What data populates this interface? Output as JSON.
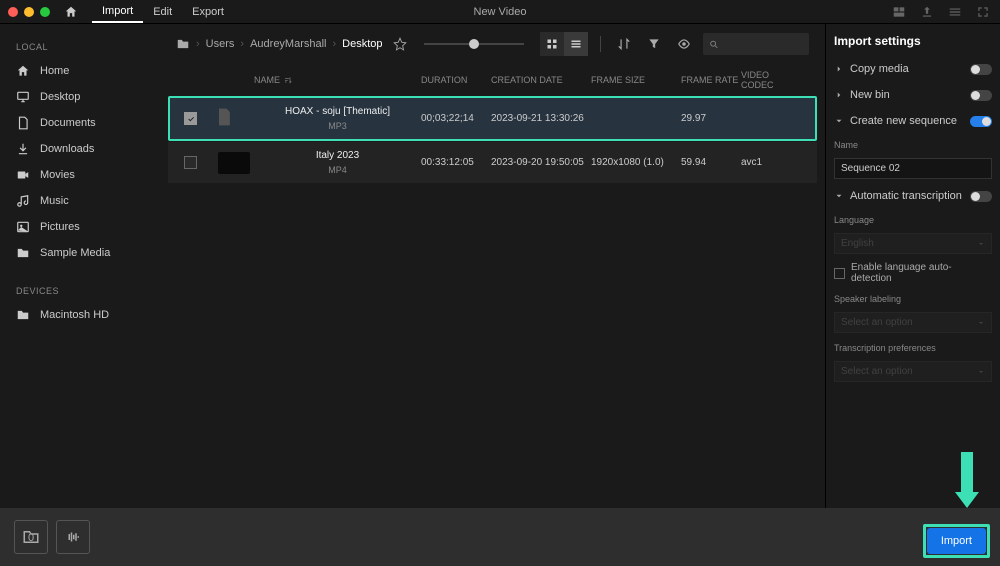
{
  "window": {
    "title": "New Video"
  },
  "menu": {
    "home": "Home",
    "import": "Import",
    "edit": "Edit",
    "export": "Export"
  },
  "sidebar": {
    "localLabel": "LOCAL",
    "devicesLabel": "DEVICES",
    "local": [
      {
        "label": "Home",
        "icon": "home"
      },
      {
        "label": "Desktop",
        "icon": "monitor"
      },
      {
        "label": "Documents",
        "icon": "document"
      },
      {
        "label": "Downloads",
        "icon": "download"
      },
      {
        "label": "Movies",
        "icon": "video"
      },
      {
        "label": "Music",
        "icon": "music"
      },
      {
        "label": "Pictures",
        "icon": "image"
      },
      {
        "label": "Sample Media",
        "icon": "folder"
      }
    ],
    "devices": [
      {
        "label": "Macintosh HD",
        "icon": "folder"
      }
    ]
  },
  "breadcrumb": [
    "Users",
    "AudreyMarshall",
    "Desktop"
  ],
  "columns": {
    "name": "NAME",
    "duration": "DURATION",
    "date": "CREATION DATE",
    "size": "FRAME SIZE",
    "rate": "FRAME RATE",
    "codec": "VIDEO CODEC"
  },
  "files": [
    {
      "name": "HOAX - soju [Thematic]",
      "ext": "MP3",
      "duration": "00;03;22;14",
      "date": "2023-09-21 13:30:26",
      "size": "",
      "rate": "29.97",
      "codec": "",
      "selected": true,
      "thumb": "doc"
    },
    {
      "name": "Italy 2023",
      "ext": "MP4",
      "duration": "00:33:12:05",
      "date": "2023-09-20 19:50:05",
      "size": "1920x1080 (1.0)",
      "rate": "59.94",
      "codec": "avc1",
      "selected": false,
      "thumb": "dark"
    }
  ],
  "settings": {
    "title": "Import settings",
    "copyMedia": {
      "label": "Copy media",
      "on": false
    },
    "newBin": {
      "label": "New bin",
      "on": false
    },
    "createSeq": {
      "label": "Create new sequence",
      "on": true,
      "nameLabel": "Name",
      "value": "Sequence 02"
    },
    "transcription": {
      "label": "Automatic transcription",
      "on": false,
      "langLabel": "Language",
      "langValue": "English",
      "autoDetect": "Enable language auto-detection",
      "speakerLabel": "Speaker labeling",
      "speakerValue": "Select an option",
      "prefLabel": "Transcription preferences",
      "prefValue": "Select an option"
    }
  },
  "footer": {
    "count": "0",
    "import": "Import"
  }
}
